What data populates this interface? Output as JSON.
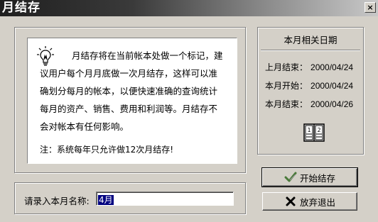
{
  "window": {
    "title": "月结存",
    "close_label": "×"
  },
  "message": {
    "text": "月结存将在当前帐本处做一个标记，建议用户每个月月底做一次月结存，这样可以准确划分每月的帐本，以便快速准确的查询统计每月的资产、销售、费用和利润等。月结存不会对帐本有任何影响。",
    "note": "注：系统每年只允许做12次月结存!",
    "icon": "lightbulb-icon"
  },
  "info": {
    "title": "本月相关日期",
    "rows": [
      {
        "label": "上月结束：",
        "value": "2000/04/24"
      },
      {
        "label": "本月开始：",
        "value": "2000/04/24"
      },
      {
        "label": "本月结束：",
        "value": "2000/04/26"
      }
    ],
    "icon": "book-icon"
  },
  "buttons": {
    "start_label": "开始结存",
    "start_icon": "checkmark-icon",
    "exit_label": "放弃退出",
    "exit_icon": "x-mark-icon"
  },
  "name_field": {
    "label": "请录入本月名称:",
    "value": "4月"
  },
  "colors": {
    "face": "#d4d0c8",
    "selection": "#000080",
    "check": "#4a7a3a"
  }
}
